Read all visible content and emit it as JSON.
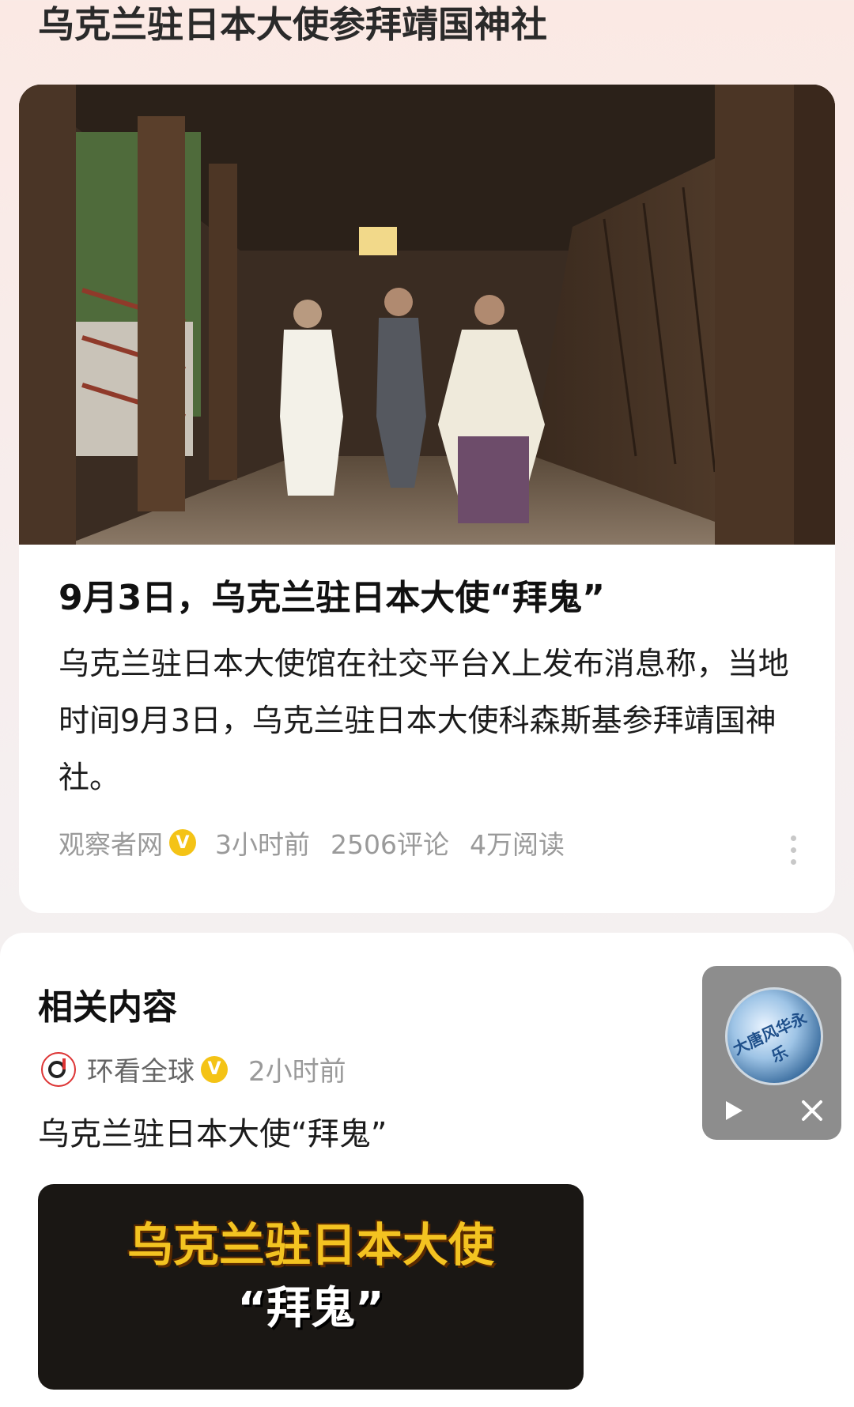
{
  "topic": {
    "title": "乌克兰驻日本大使参拜靖国神社"
  },
  "article": {
    "headline": "9月3日，乌克兰驻日本大使“拜鬼”",
    "summary": "乌克兰驻日本大使馆在社交平台X上发布消息称，当地时间9月3日，乌克兰驻日本大使科森斯基参拜靖国神社。",
    "source": "观察者网",
    "verified_mark": "V",
    "time": "3小时前",
    "comments": "2506评论",
    "reads": "4万阅读"
  },
  "related": {
    "section_title": "相关内容",
    "source": "环看全球",
    "verified_mark": "V",
    "time": "2小时前",
    "headline": "乌克兰驻日本大使“拜鬼”",
    "thumb_line1": "乌克兰驻日本大使",
    "thumb_line2": "“拜鬼”"
  },
  "player": {
    "disc_text": "大唐风华永乐"
  },
  "colors": {
    "verified": "#f4c316",
    "accent_logo": "#d33333"
  },
  "icons": [
    "verified-icon",
    "more-icon",
    "source-logo-icon",
    "play-icon",
    "close-icon"
  ]
}
